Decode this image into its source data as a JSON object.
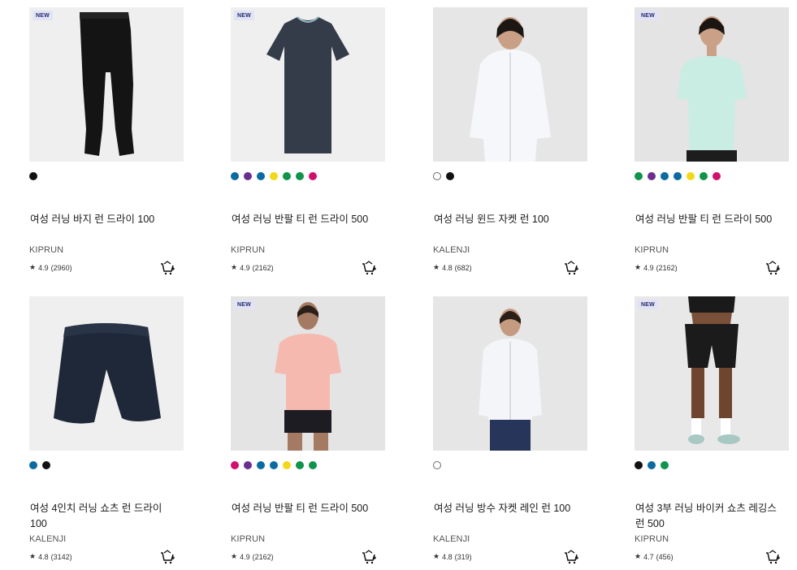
{
  "products": [
    {
      "badge": "NEW",
      "title": "여성 러닝 바지 런 드라이 100",
      "brand": "KIPRUN",
      "rating": "4.9",
      "reviews": "(2960)",
      "swatches": [
        "#111111"
      ]
    },
    {
      "badge": "NEW",
      "title": "여성 러닝 반팔 티 런 드라이 500",
      "brand": "KIPRUN",
      "rating": "4.9",
      "reviews": "(2162)",
      "swatches": [
        "#0a6aa1",
        "#6a2e91",
        "#0a6aa1",
        "#f2d81b",
        "#10934a",
        "#10934a",
        "#d10f6f"
      ]
    },
    {
      "badge": "",
      "title": "여성 러닝 윈드 자켓 런 100",
      "brand": "KALENJI",
      "rating": "4.8",
      "reviews": "(682)",
      "swatches": [
        "hollow",
        "#111111"
      ]
    },
    {
      "badge": "NEW",
      "title": "여성 러닝 반팔 티 런 드라이 500",
      "brand": "KIPRUN",
      "rating": "4.9",
      "reviews": "(2162)",
      "swatches": [
        "#10934a",
        "#6a2e91",
        "#0a6aa1",
        "#0a6aa1",
        "#f2d81b",
        "#10934a",
        "#d10f6f"
      ]
    },
    {
      "badge": "",
      "title": "여성 4인치 러닝 쇼츠 런 드라이 100",
      "brand": "KALENJI",
      "rating": "4.8",
      "reviews": "(3142)",
      "swatches": [
        "#0a6aa1",
        "#111111"
      ]
    },
    {
      "badge": "NEW",
      "title": "여성 러닝 반팔 티 런 드라이 500",
      "brand": "KIPRUN",
      "rating": "4.9",
      "reviews": "(2162)",
      "swatches": [
        "#d10f6f",
        "#6a2e91",
        "#0a6aa1",
        "#0a6aa1",
        "#f2d81b",
        "#10934a",
        "#10934a"
      ]
    },
    {
      "badge": "",
      "title": "여성 러닝 방수 자켓 레인 런 100",
      "brand": "KALENJI",
      "rating": "4.8",
      "reviews": "(319)",
      "swatches": [
        "hollow"
      ]
    },
    {
      "badge": "NEW",
      "title": "여성 3부 러닝 바이커 쇼츠 레깅스 런 500",
      "brand": "KIPRUN",
      "rating": "4.7",
      "reviews": "(456)",
      "swatches": [
        "#111111",
        "#0a6aa1",
        "#10934a"
      ]
    }
  ],
  "icons": {
    "star": "star-icon",
    "cart": "add-to-cart-icon"
  },
  "colors": {
    "badge_bg": "#e1e4f5",
    "badge_text": "#242a6b",
    "image_bg": "#f0f0f0"
  }
}
